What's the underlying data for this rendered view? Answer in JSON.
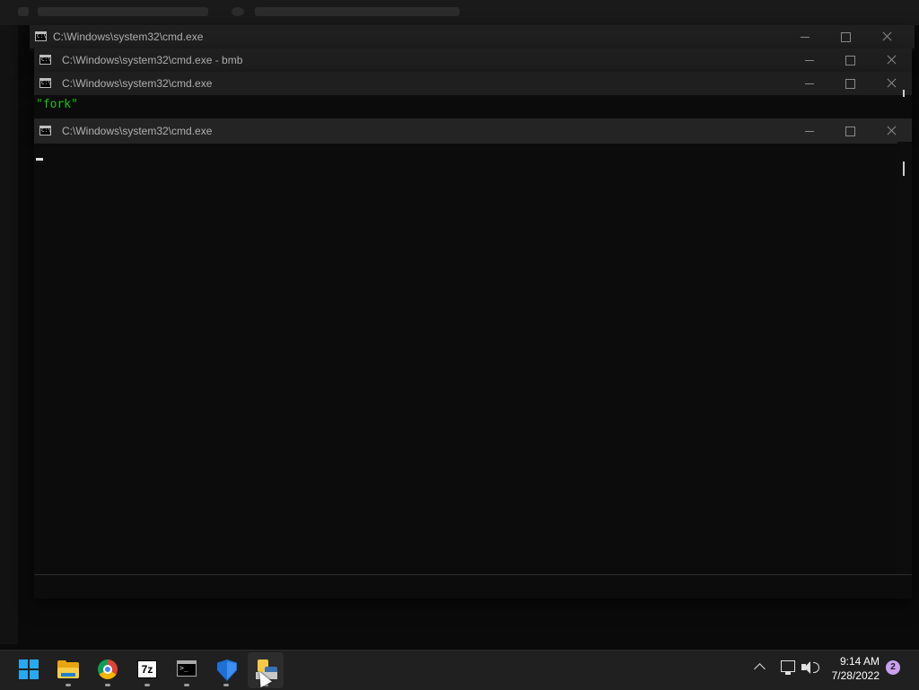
{
  "windows": [
    {
      "title": "C:\\Windows\\system32\\cmd.exe"
    },
    {
      "title": "C:\\Windows\\system32\\cmd.exe - bmb"
    },
    {
      "title": "C:\\Windows\\system32\\cmd.exe",
      "console_line": "\"fork\""
    },
    {
      "title": "C:\\Windows\\system32\\cmd.exe"
    }
  ],
  "taskbar": {
    "apps": [
      {
        "name": "start",
        "icon": "windows-logo-icon"
      },
      {
        "name": "file-explorer",
        "icon": "folder-icon"
      },
      {
        "name": "chrome",
        "icon": "chrome-icon"
      },
      {
        "name": "7-zip",
        "icon": "7zip-icon",
        "label": "7z"
      },
      {
        "name": "command-prompt",
        "icon": "cmd-icon"
      },
      {
        "name": "windows-security",
        "icon": "shield-icon"
      },
      {
        "name": "python",
        "icon": "python-icon"
      }
    ],
    "tray": {
      "time": "9:14 AM",
      "date": "7/28/2022",
      "notifications": "2"
    }
  },
  "colors": {
    "console_bg": "#0c0c0c",
    "console_green": "#16c60c",
    "taskbar_bg": "#202020"
  }
}
